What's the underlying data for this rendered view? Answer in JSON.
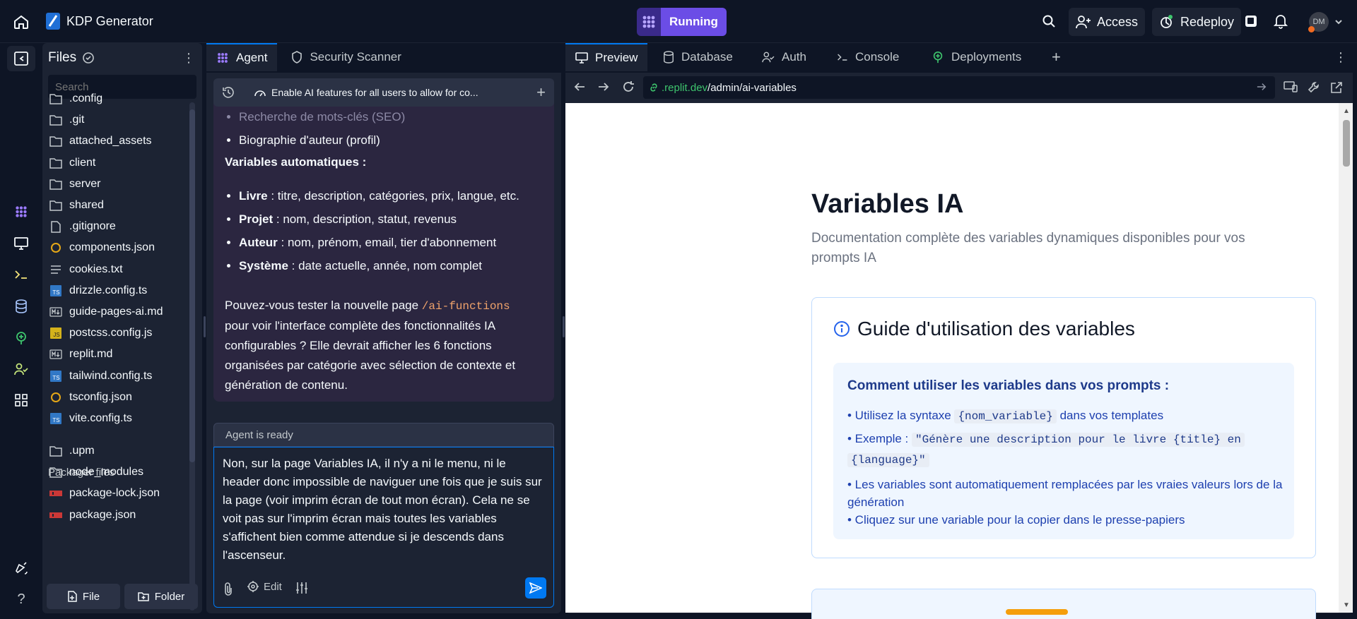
{
  "topbar": {
    "app_name": "KDP Generator",
    "run_status": "Running",
    "access_label": "Access",
    "redeploy_label": "Redeploy",
    "avatar_initials": "DM"
  },
  "files": {
    "title": "Files",
    "search_placeholder": "Search",
    "items": [
      {
        "name": ".config",
        "type": "folder"
      },
      {
        "name": ".git",
        "type": "folder"
      },
      {
        "name": "attached_assets",
        "type": "folder"
      },
      {
        "name": "client",
        "type": "folder"
      },
      {
        "name": "server",
        "type": "folder"
      },
      {
        "name": "shared",
        "type": "folder"
      },
      {
        "name": ".gitignore",
        "type": "file"
      },
      {
        "name": "components.json",
        "type": "json"
      },
      {
        "name": "cookies.txt",
        "type": "text"
      },
      {
        "name": "drizzle.config.ts",
        "type": "ts"
      },
      {
        "name": "guide-pages-ai.md",
        "type": "md"
      },
      {
        "name": "postcss.config.js",
        "type": "js"
      },
      {
        "name": "replit.md",
        "type": "md"
      },
      {
        "name": "tailwind.config.ts",
        "type": "ts"
      },
      {
        "name": "tsconfig.json",
        "type": "json"
      },
      {
        "name": "vite.config.ts",
        "type": "ts"
      }
    ],
    "packager_title": "Packager files",
    "packager_items": [
      {
        "name": ".upm",
        "type": "folder"
      },
      {
        "name": "node_modules",
        "type": "folder"
      },
      {
        "name": "package-lock.json",
        "type": "npm"
      },
      {
        "name": "package.json",
        "type": "npm"
      }
    ],
    "new_file_label": "File",
    "new_folder_label": "Folder"
  },
  "agent": {
    "tabs": [
      "Agent",
      "Security Scanner"
    ],
    "banner": "Enable AI features for all users to allow for co...",
    "faded_item": "Recherche de mots-clés (SEO)",
    "item_bio": "Biographie d'auteur (profil)",
    "auto_heading": "Variables automatiques :",
    "auto_items": [
      {
        "key": "Livre",
        "text": " : titre, description, catégories, prix, langue, etc."
      },
      {
        "key": "Projet",
        "text": " : nom, description, statut, revenus"
      },
      {
        "key": "Auteur",
        "text": " : nom, prénom, email, tier d'abonnement"
      },
      {
        "key": "Système",
        "text": " : date actuelle, année, nom complet"
      }
    ],
    "question_before": "Pouvez-vous tester la nouvelle page ",
    "question_code": "/ai-functions",
    "question_after": "pour voir l'interface complète des fonctionnalités IA configurables ? Elle devrait afficher les 6 fonctions organisées par catégorie avec sélection de contexte et génération de contenu.",
    "status": "Agent is ready",
    "input_text": "Non, sur la page Variables IA, il n'y a ni le menu, ni le header donc impossible de naviguer une fois que je suis sur la page (voir imprim écran de tout mon écran). Cela ne se voit pas sur l'imprim écran mais toutes les variables s'affichent bien comme attendue si je descends dans l'ascenseur.",
    "edit_label": "Edit"
  },
  "preview": {
    "tabs": [
      "Preview",
      "Database",
      "Auth",
      "Console",
      "Deployments"
    ],
    "url_domain": ".replit.dev",
    "url_path": "/admin/ai-variables"
  },
  "webpage": {
    "title": "Variables IA",
    "subtitle": "Documentation complète des variables dynamiques disponibles pour vos prompts IA",
    "guide_title": "Guide d'utilisation des variables",
    "howto_title": "Comment utiliser les variables dans vos prompts :",
    "bullet1_before": "• Utilisez la syntaxe ",
    "bullet1_code": "{nom_variable}",
    "bullet1_after": " dans vos templates",
    "bullet2_before": "• Exemple : ",
    "bullet2_code_line1": "\"Génère une description pour le livre {title} en",
    "bullet2_code_line2": "{language}\"",
    "bullet3": "• Les variables sont automatiquement remplacées par les vraies valeurs lors de la génération",
    "bullet4": "• Cliquez sur une variable pour la copier dans le presse-papiers"
  },
  "colors": {
    "bg": "#0e1525",
    "panel": "#1c2333",
    "agent_bubble": "#2b2640",
    "running": "#6b4de6",
    "accent": "#0079f2",
    "web_blue": "#1e3a8a"
  }
}
